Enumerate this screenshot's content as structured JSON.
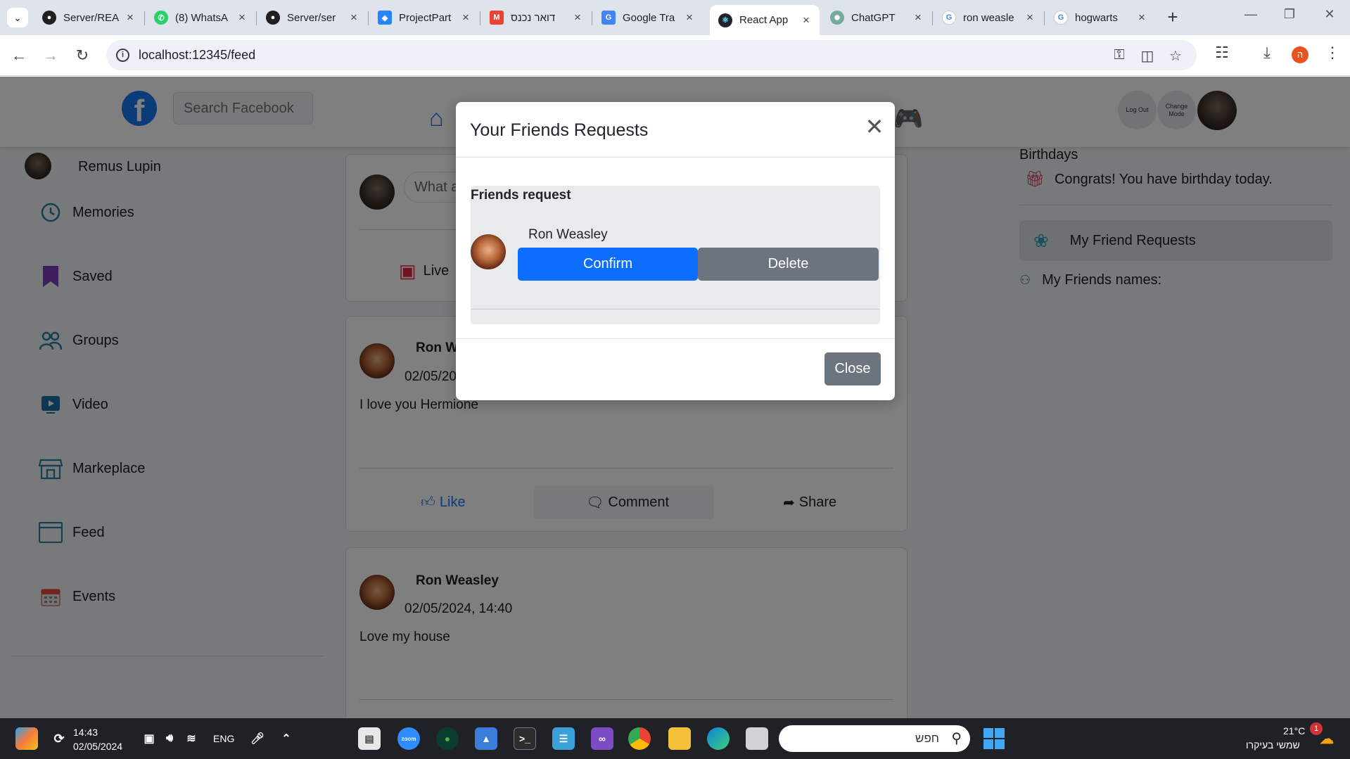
{
  "browser": {
    "tabs": [
      {
        "label": "Server/REA",
        "icon": "github-icon"
      },
      {
        "label": "(8) WhatsA",
        "icon": "whatsapp-icon"
      },
      {
        "label": "Server/ser",
        "icon": "github-icon"
      },
      {
        "label": "ProjectPart",
        "icon": "jira-icon"
      },
      {
        "label": "דואר נכנס",
        "icon": "gmail-icon"
      },
      {
        "label": "Google Tra",
        "icon": "google-translate-icon"
      },
      {
        "label": "React App",
        "icon": "react-icon",
        "active": true
      },
      {
        "label": "ChatGPT",
        "icon": "chatgpt-icon"
      },
      {
        "label": "ron weasle",
        "icon": "google-icon"
      },
      {
        "label": "hogwarts",
        "icon": "google-icon"
      }
    ],
    "url": "localhost:12345/feed",
    "profile_initial": "ה"
  },
  "header": {
    "logo": "f",
    "search_placeholder": "Search Facebook",
    "logout_label": "Log Out",
    "change_mode_label": "Change Mode"
  },
  "sidebar": {
    "user_name": "Remus Lupin",
    "items": [
      {
        "label": "Memories",
        "icon": "clock-icon"
      },
      {
        "label": "Saved",
        "icon": "bookmark-icon"
      },
      {
        "label": "Groups",
        "icon": "groups-icon"
      },
      {
        "label": "Video",
        "icon": "video-icon"
      },
      {
        "label": "Markeplace",
        "icon": "store-icon"
      },
      {
        "label": "Feed",
        "icon": "feed-icon"
      },
      {
        "label": "Events",
        "icon": "calendar-icon"
      }
    ]
  },
  "composer": {
    "placeholder": "What a",
    "live_label": "Live"
  },
  "posts": [
    {
      "author": "Ron W",
      "date": "02/05/20",
      "text": "I love you Hermione",
      "like": "Like",
      "comment": "Comment",
      "share": "Share"
    },
    {
      "author": "Ron Weasley",
      "date": "02/05/2024, 14:40",
      "text": "Love my house"
    }
  ],
  "right": {
    "birthdays_title": "Birthdays",
    "birthday_text": "Congrats! You have birthday today.",
    "friend_requests_label": "My Friend Requests",
    "friends_names_label": "My Friends names:"
  },
  "modal": {
    "title": "Your Friends Requests",
    "section_title": "Friends request",
    "request_name": "Ron Weasley",
    "confirm_label": "Confirm",
    "delete_label": "Delete",
    "close_label": "Close"
  },
  "taskbar": {
    "time": "14:43",
    "date": "02/05/2024",
    "lang": "ENG",
    "search_label": "חפש",
    "temperature": "21°C",
    "weather_text": "שמשי בעיקרו",
    "notification_count": "1"
  },
  "colors": {
    "primary": "#0d6efd",
    "secondary": "#6c757d",
    "facebook_blue": "#1877f2",
    "sidebar_icon": "#2b7fa3"
  }
}
